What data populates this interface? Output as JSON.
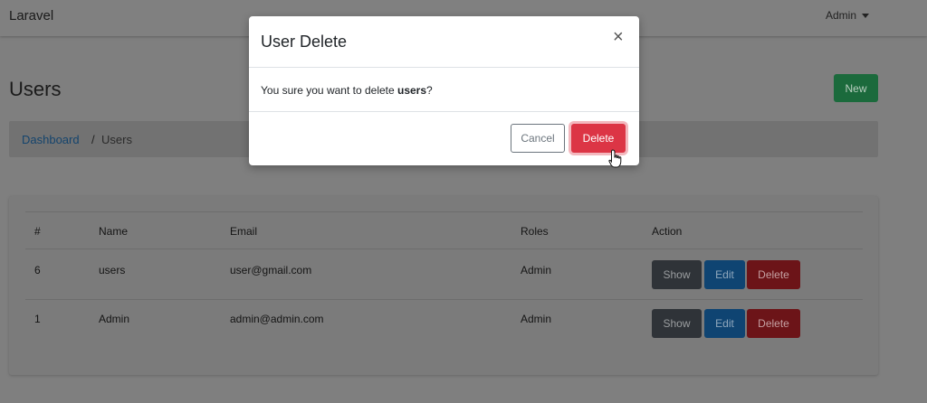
{
  "navbar": {
    "brand": "Laravel",
    "user": "Admin"
  },
  "page": {
    "title": "Users",
    "new_button": "New"
  },
  "breadcrumb": {
    "items": [
      "Dashboard",
      "/",
      "Users"
    ]
  },
  "table": {
    "headers": [
      "#",
      "Name",
      "Email",
      "Roles",
      "Action"
    ],
    "rows": [
      {
        "id": "6",
        "name": "users",
        "email": "user@gmail.com",
        "role": "Admin"
      },
      {
        "id": "1",
        "name": "Admin",
        "email": "admin@admin.com",
        "role": "Admin"
      }
    ],
    "actions": {
      "show": "Show",
      "edit": "Edit",
      "delete": "Delete"
    }
  },
  "modal": {
    "title": "User Delete",
    "close": "×",
    "message_prefix": "You sure you want to delete ",
    "message_target": "users",
    "message_suffix": "?",
    "cancel": "Cancel",
    "confirm": "Delete"
  },
  "colors": {
    "primary": "#0d6efd",
    "danger": "#dc3545",
    "success": "#198754",
    "secondary": "#6c757d"
  }
}
